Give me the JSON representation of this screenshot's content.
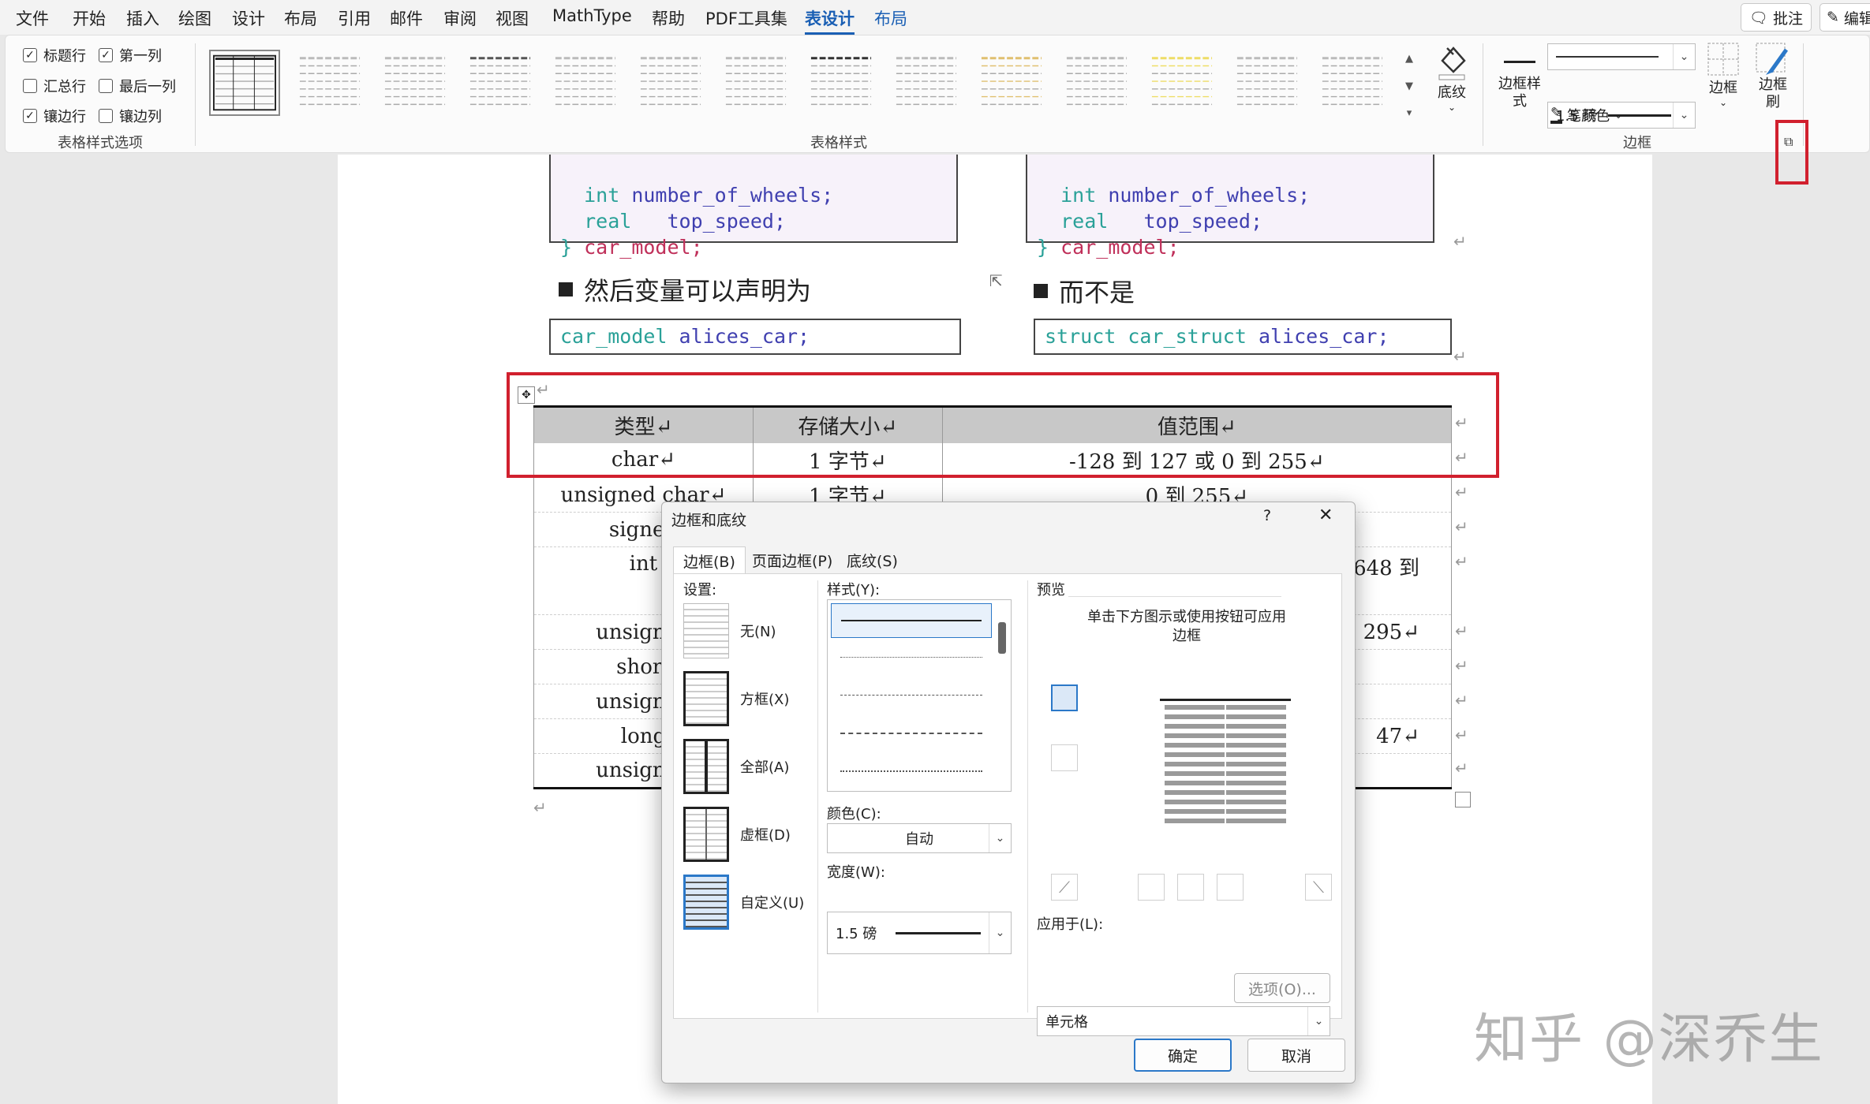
{
  "menubar": {
    "items": [
      "文件",
      "开始",
      "插入",
      "绘图",
      "设计",
      "布局",
      "引用",
      "邮件",
      "审阅",
      "视图",
      "MathType",
      "帮助",
      "PDF工具集",
      "表设计",
      "布局"
    ],
    "right_buttons": [
      "批注",
      "编辑"
    ]
  },
  "ribbon": {
    "style_options": {
      "items": [
        {
          "label": "标题行",
          "checked": true
        },
        {
          "label": "第一列",
          "checked": true
        },
        {
          "label": "汇总行",
          "checked": false
        },
        {
          "label": "最后一列",
          "checked": false
        },
        {
          "label": "镶边行",
          "checked": true
        },
        {
          "label": "镶边列",
          "checked": false
        }
      ],
      "group_label": "表格样式选项"
    },
    "table_styles_label": "表格样式",
    "shading_label": "底纹",
    "border_styles_label": "边框样式",
    "pen_weight": "1.5 磅",
    "pen_color_label": "笔颜色",
    "borders_label": "边框",
    "border_painter_label": "边框刷",
    "borders_group_label": "边框",
    "check_mark": "✓"
  },
  "document": {
    "code_left": {
      "l1_kw": "int",
      "l1_nm": "number_of_wheels;",
      "l2_kw": "real",
      "l2_nm": "top_speed;",
      "l3_brace": "}",
      "l3_nm": "car_model;"
    },
    "code_right": {
      "l1_kw": "int",
      "l1_nm": "number_of_wheels;",
      "l2_kw": "real",
      "l2_nm": "top_speed;",
      "l3_brace": "}",
      "l3_nm": "car_model;"
    },
    "heading_left": "然后变量可以声明为",
    "heading_right": "而不是",
    "decl_left_type": "car_model",
    "decl_left_var": "alices_car;",
    "decl_right_kw": "struct",
    "decl_right_type": "car_struct",
    "decl_right_var": "alices_car;",
    "return_mark": "↵",
    "table": {
      "headers": [
        "类型↵",
        "存储大小↵",
        "值范围↵"
      ],
      "rows": [
        [
          "char↵",
          "1 字节↵",
          "-128 到 127 或 0 到 255↵"
        ],
        [
          "unsigned char↵",
          "1 字节↵",
          "0 到 255↵"
        ],
        [
          "signed",
          "",
          " "
        ],
        [
          "int",
          "",
          "648 到"
        ],
        [
          "unsigned",
          "",
          "295↵"
        ],
        [
          "short",
          "",
          ""
        ],
        [
          "unsigned",
          "",
          ""
        ],
        [
          "long",
          "",
          "47↵"
        ],
        [
          "unsigned",
          "",
          ""
        ]
      ]
    }
  },
  "dialog": {
    "title": "边框和底纹",
    "help": "?",
    "close": "✕",
    "tabs": [
      "边框(B)",
      "页面边框(P)",
      "底纹(S)"
    ],
    "settings_label": "设置:",
    "settings": [
      "无(N)",
      "方框(X)",
      "全部(A)",
      "虚框(D)",
      "自定义(U)"
    ],
    "style_label": "样式(Y):",
    "color_label": "颜色(C):",
    "color_value": "自动",
    "width_label": "宽度(W):",
    "width_value": "1.5 磅",
    "preview_label": "预览",
    "preview_hint_1": "单击下方图示或使用按钮可应用",
    "preview_hint_2": "边框",
    "apply_label": "应用于(L):",
    "apply_value": "单元格",
    "options_button": "选项(O)...",
    "ok": "确定",
    "cancel": "取消"
  },
  "watermark": "知乎 @深乔生"
}
